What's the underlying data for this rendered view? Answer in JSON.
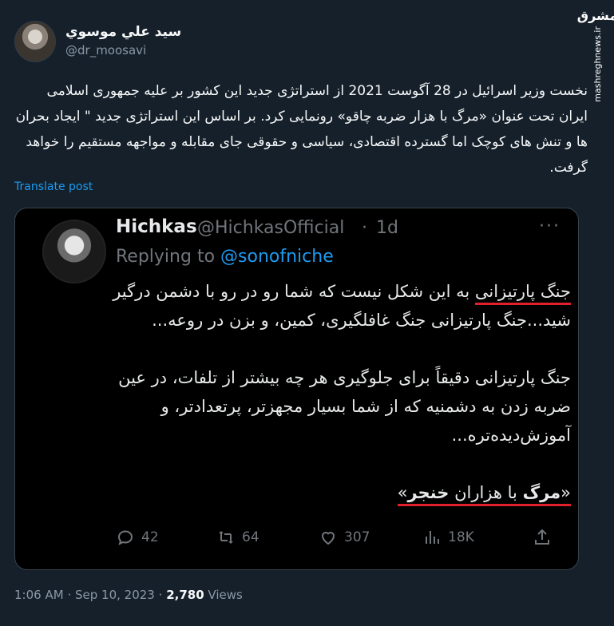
{
  "author": {
    "display_name": "سيد علي موسوي",
    "handle": "@dr_moosavi"
  },
  "watermark": {
    "logo_text": "مشرق",
    "site": "mashreghnews.ir"
  },
  "tweet": {
    "text": "نخست وزیر اسرائیل در 28 آگوست 2021 از استراتژی جدید این کشور بر علیه جمهوری اسلامی ایران تحت عنوان «مرگ با هزار ضربه چاقو» رونمایی کرد. بر اساس این استراتژی جدید \" ایجاد بحران ها و تنش های کوچک اما گسترده اقتصادی، سیاسی و حقوقی جای مقابله و مواجهه مستقیم را خواهد گرفت.",
    "translate_label": "Translate post"
  },
  "quote": {
    "name": "Hichkas",
    "handle": "@HichkasOfficial",
    "separator": "·",
    "time": "1d",
    "more_label": "···",
    "replying_prefix": "Replying to",
    "replying_to": "@sonofniche",
    "para1_highlight": "جنگ پارتیزانی",
    "para1_rest": " به این شکل نیست که شما رو در رو با دشمن درگیر شید...جنگ پارتیزانی جنگ غافلگیری، کمین، و بزن در روعه...",
    "para2": "جنگ پارتیزانی دقیقاً برای جلوگیری هر چه بیشتر از تلفات، در عین ضربه زدن به دشمنیه که از شما بسیار مجهزتر، پرتعدادتر، و آموزش‌دیده‌تره...",
    "closing_open": "«",
    "closing_word1": "مرگ",
    "closing_mid": " با هزاران ",
    "closing_word2": "خنجر",
    "closing_close": "»",
    "stats": {
      "replies": "42",
      "reposts": "64",
      "likes": "307",
      "views": "18K"
    }
  },
  "footer": {
    "time": "1:06 AM",
    "date": "Sep 10, 2023",
    "views_count": "2,780",
    "views_label": "Views",
    "separator": "·"
  }
}
